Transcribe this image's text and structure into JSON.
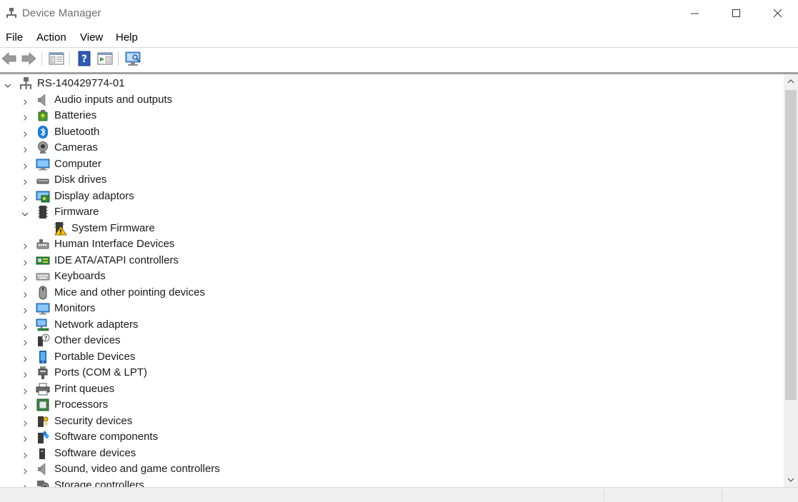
{
  "window": {
    "title": "Device Manager",
    "icon": "device-manager-icon",
    "controls": [
      "minimize-icon",
      "maximize-icon",
      "close-icon"
    ]
  },
  "menu": {
    "items": [
      "File",
      "Action",
      "View",
      "Help"
    ]
  },
  "toolbar": {
    "buttons": [
      "back-arrow-icon",
      "forward-arrow-icon",
      "properties-icon",
      "help-icon",
      "update-driver-icon",
      "scan-hardware-icon"
    ]
  },
  "tree": {
    "root": {
      "label": "RS-140429774-01",
      "icon": "computer-network-icon",
      "expanded": true
    },
    "categories": [
      {
        "label": "Audio inputs and outputs",
        "icon": "speaker-icon",
        "expanded": false
      },
      {
        "label": "Batteries",
        "icon": "battery-icon",
        "expanded": false
      },
      {
        "label": "Bluetooth",
        "icon": "bluetooth-icon",
        "expanded": false
      },
      {
        "label": "Cameras",
        "icon": "camera-icon",
        "expanded": false
      },
      {
        "label": "Computer",
        "icon": "computer-icon",
        "expanded": false
      },
      {
        "label": "Disk drives",
        "icon": "disk-drive-icon",
        "expanded": false
      },
      {
        "label": "Display adaptors",
        "icon": "display-adapter-icon",
        "expanded": false
      },
      {
        "label": "Firmware",
        "icon": "firmware-icon",
        "expanded": true,
        "children": [
          {
            "label": "System Firmware",
            "icon": "firmware-warning-icon"
          }
        ]
      },
      {
        "label": "Human Interface Devices",
        "icon": "hid-icon",
        "expanded": false
      },
      {
        "label": "IDE ATA/ATAPI controllers",
        "icon": "ide-controller-icon",
        "expanded": false
      },
      {
        "label": "Keyboards",
        "icon": "keyboard-icon",
        "expanded": false
      },
      {
        "label": "Mice and other pointing devices",
        "icon": "mouse-icon",
        "expanded": false
      },
      {
        "label": "Monitors",
        "icon": "monitor-icon",
        "expanded": false
      },
      {
        "label": "Network adapters",
        "icon": "network-adapter-icon",
        "expanded": false
      },
      {
        "label": "Other devices",
        "icon": "other-devices-icon",
        "expanded": false
      },
      {
        "label": "Portable Devices",
        "icon": "portable-device-icon",
        "expanded": false
      },
      {
        "label": "Ports (COM & LPT)",
        "icon": "port-icon",
        "expanded": false
      },
      {
        "label": "Print queues",
        "icon": "printer-icon",
        "expanded": false
      },
      {
        "label": "Processors",
        "icon": "processor-icon",
        "expanded": false
      },
      {
        "label": "Security devices",
        "icon": "security-device-icon",
        "expanded": false
      },
      {
        "label": "Software components",
        "icon": "software-component-icon",
        "expanded": false
      },
      {
        "label": "Software devices",
        "icon": "software-device-icon",
        "expanded": false
      },
      {
        "label": "Sound, video and game controllers",
        "icon": "sound-controller-icon",
        "expanded": false
      },
      {
        "label": "Storage controllers",
        "icon": "storage-controller-icon",
        "expanded": false
      }
    ]
  },
  "colors": {
    "accent": "#0078d7",
    "warning": "#f5c400",
    "scrollbar_thumb": "#cdcdcd"
  }
}
